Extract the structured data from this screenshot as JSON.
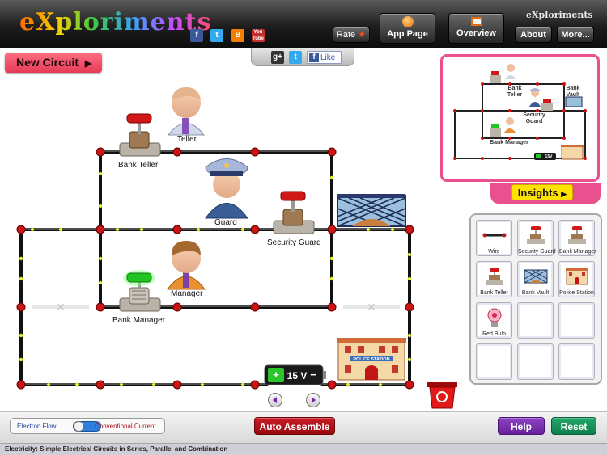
{
  "header": {
    "logo_text": "eXploriments",
    "brand_small": "eXploriments",
    "social_icons": [
      "facebook-icon",
      "twitter-icon",
      "blogger-icon",
      "youtube-icon"
    ],
    "youtube_label": "You Tube",
    "buttons": {
      "rate": "Rate",
      "app_page": "App Page",
      "overview": "Overview",
      "about": "About",
      "more": "More..."
    }
  },
  "share": {
    "like_label": "Like",
    "gplus_label": "g+",
    "twitter_label": "t",
    "facebook_label": "f"
  },
  "new_circuit_label": "New Circuit",
  "circuit": {
    "labels": {
      "teller": "Teller",
      "bank_teller": "Bank Teller",
      "guard": "Guard",
      "security_guard": "Security Guard",
      "manager": "Manager",
      "bank_manager": "Bank Manager"
    },
    "battery_label": "15 V",
    "station_sign": "POLICE STATION"
  },
  "minimap": {
    "labels": {
      "bank_teller": "Bank Teller",
      "bank_vault": "Bank Vault",
      "security_guard": "Security Guard",
      "bank_manager": "Bank Manager",
      "battery": "15V"
    }
  },
  "insights_label": "Insights",
  "palette": {
    "items": [
      "Wire",
      "Security Guard",
      "Bank Manager",
      "Bank Teller",
      "Bank Vault",
      "Police Station",
      "Red Bulb",
      "",
      "",
      "",
      "",
      ""
    ]
  },
  "bottom": {
    "electron_flow": "Electron Flow",
    "conventional_current": "Conventional Current",
    "auto_assemble": "Auto Assemble",
    "help": "Help",
    "reset": "Reset"
  },
  "footer_text": "Electricity: Simple Electrical Circuits in Series, Parallel and Combination",
  "colors": {
    "accent_pink": "#ea4f8e",
    "new_circuit_red": "#e63a57",
    "help_purple": "#7b2fae",
    "reset_green": "#17935b",
    "auto_red": "#b3101b",
    "insights_yellow": "#ffe200"
  }
}
